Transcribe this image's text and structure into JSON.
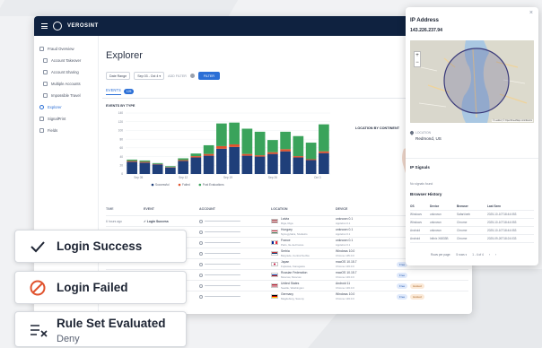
{
  "app": {
    "brand": "VEROSINT",
    "page_title": "Explorer",
    "sidebar": [
      {
        "label": "Fraud Overview",
        "sub": false
      },
      {
        "label": "Account Takeover",
        "sub": true
      },
      {
        "label": "Account Sharing",
        "sub": true
      },
      {
        "label": "Multiple Accounts",
        "sub": true
      },
      {
        "label": "Impossible Travel",
        "sub": true
      },
      {
        "label": "Explorer",
        "sub": false,
        "active": true
      },
      {
        "label": "SignalPrint",
        "sub": false
      },
      {
        "label": "Fields",
        "sub": false
      }
    ],
    "filters": {
      "date_range_label": "Date Range",
      "date_range_value": "Sep 03 - Oct 4",
      "add_filter_label": "ADD FILTER",
      "filter_button": "FILTER"
    },
    "tabs": [
      {
        "label": "EVENTS",
        "count": "125"
      }
    ],
    "chart_title": "EVENTS BY TYPE",
    "map_title": "LOCATION BY CONTINENT",
    "table": {
      "columns": [
        "TIME",
        "EVENT",
        "ACCOUNT",
        "LOCATION",
        "DEVICE"
      ],
      "rows": [
        {
          "time": "6 hours ago",
          "event": "Login Success",
          "loc": "Latvia",
          "loc_sub": "Riga, Riga",
          "dev": "unknown 0.1",
          "dev_sub": "Applebot 0.1",
          "flag": "latvia",
          "tags": []
        },
        {
          "time": "6 hours ago",
          "event": "Login Success",
          "loc": "Hungary",
          "loc_sub": "Nyíregyháza, Szabolcs",
          "dev": "unknown 0.1",
          "dev_sub": "Applebot 0.1",
          "flag": "hungary",
          "tags": []
        },
        {
          "time": "6 hours ago",
          "event": "Login Success",
          "loc": "France",
          "loc_sub": "Paris, Ile-de-France",
          "dev": "unknown 0.1",
          "dev_sub": "Applebot 0.1",
          "flag": "france",
          "tags": []
        },
        {
          "time": "",
          "event": "",
          "loc": "Serbia",
          "loc_sub": "Belgrade, Central Serbia",
          "dev": "Windows 10.0",
          "dev_sub": "Chrome 135.0.0",
          "flag": "serbia",
          "tags": []
        },
        {
          "time": "",
          "event": "",
          "loc": "Japan",
          "loc_sub": "Fujisawa, Kanagawa",
          "dev": "macOS 10.15.7",
          "dev_sub": "Chrome 133.0.0",
          "flag": "japan",
          "tags": [
            "Free"
          ]
        },
        {
          "time": "",
          "event": "",
          "loc": "Russian Federation",
          "loc_sub": "Moscow, Moscow",
          "dev": "macOS 10.15.7",
          "dev_sub": "Chrome 133.0.0",
          "flag": "russia",
          "tags": [
            "Free"
          ]
        },
        {
          "time": "",
          "event": "",
          "loc": "United States",
          "loc_sub": "Seattle, Washington",
          "dev": "Android 11",
          "dev_sub": "Chrome 133.0.0",
          "flag": "usa",
          "tags": [
            "Free",
            "Hosted"
          ]
        },
        {
          "time": "",
          "event": "",
          "loc": "Germany",
          "loc_sub": "Magdeburg, Saxony",
          "dev": "Windows 10.0",
          "dev_sub": "Chrome 133.0.0",
          "flag": "germany",
          "tags": [
            "Free",
            "Hosted"
          ]
        }
      ]
    }
  },
  "chart_data": {
    "type": "bar",
    "title": "EVENTS BY TYPE",
    "ylim": [
      0,
      140
    ],
    "yticks": [
      "0",
      "20",
      "40",
      "60",
      "80",
      "100",
      "120",
      "140"
    ],
    "x_ticks": [
      "Sep 05",
      "Sep 12",
      "Sep 19",
      "Sep 26",
      "Oct 3"
    ],
    "series": [
      {
        "name": "Successful",
        "color": "#1f3f7a",
        "values": [
          28,
          26,
          22,
          15,
          30,
          38,
          42,
          58,
          62,
          42,
          40,
          46,
          52,
          38,
          32,
          48
        ]
      },
      {
        "name": "Failed",
        "color": "#e0522d",
        "values": [
          2,
          2,
          1,
          1,
          2,
          3,
          4,
          6,
          6,
          4,
          3,
          4,
          5,
          3,
          2,
          4
        ]
      },
      {
        "name": "Post Evaluations",
        "color": "#3aa35b",
        "values": [
          3,
          3,
          2,
          2,
          4,
          6,
          20,
          52,
          50,
          58,
          54,
          28,
          40,
          46,
          38,
          62
        ]
      }
    ],
    "legend": "bottom"
  },
  "panel": {
    "title": "IP Address",
    "ip": "143.226.237.94",
    "location_label": "LOCATION",
    "location_value": "Redmond, US",
    "signals_title": "IP Signals",
    "signals_empty": "No signals found",
    "history_title": "Browser History",
    "history_columns": [
      "OS",
      "Device",
      "Browser",
      "Last Seen"
    ],
    "history_rows": [
      [
        "Windows",
        "unknown",
        "Safari/web",
        "2025-10-10T18:44:053"
      ],
      [
        "Windows",
        "unknown",
        "Chrome",
        "2025-10-10T18:44:053"
      ],
      [
        "Android",
        "unknown",
        "Chrome",
        "2025-10-10T18:44:053"
      ],
      [
        "Android",
        "Infinix X6833B",
        "Chrome",
        "2025-09-26T18:24:033"
      ]
    ],
    "rows_per_page_label": "Rows per page:",
    "rows_per_page_value": "5 rows",
    "page_range": "1 - 4 of 4",
    "map_attribution": "© Leaflet | © OpenStreetMap contributors"
  },
  "cards": [
    {
      "title": "Login Success",
      "subtitle": "",
      "icon": "check-icon",
      "color": "#1d2433"
    },
    {
      "title": "Login Failed",
      "subtitle": "",
      "icon": "blocked-icon",
      "color": "#e0522d"
    },
    {
      "title": "Rule Set Evaluated",
      "subtitle": "Deny",
      "icon": "rule-set-icon",
      "color": "#1d2433"
    }
  ]
}
